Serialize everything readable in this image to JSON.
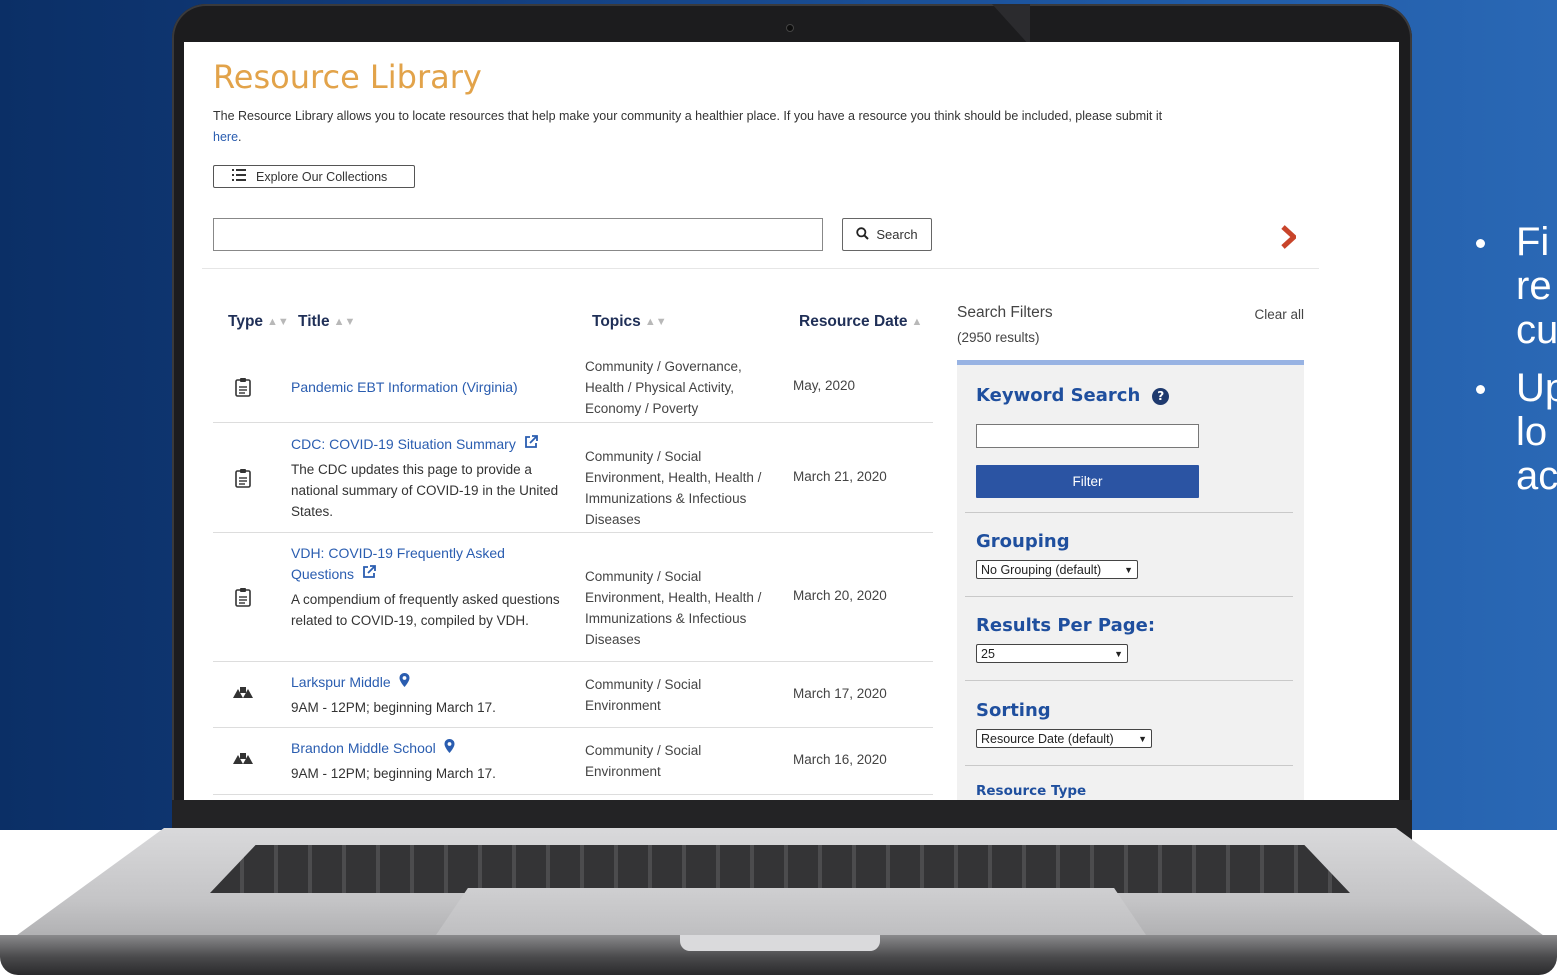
{
  "slide": {
    "bullets": [
      {
        "lines": [
          "Fi",
          "re",
          "cu"
        ]
      },
      {
        "lines": [
          "Up",
          "lo",
          "ac"
        ]
      }
    ]
  },
  "page": {
    "title": "Resource Library",
    "intro_text": "The Resource Library allows you to locate resources that help make your community a healthier place. If you have a resource you think should be included, please submit it ",
    "intro_link": "here",
    "intro_end": ".",
    "collections_button": "Explore Our Collections",
    "search_placeholder": "",
    "search_button": "Search"
  },
  "table": {
    "headers": {
      "type": "Type",
      "title": "Title",
      "topics": "Topics",
      "date": "Resource Date"
    },
    "rows": [
      {
        "icon": "document-icon",
        "title": "Pandemic EBT Information (Virginia)",
        "external": false,
        "location": false,
        "desc": "",
        "topics": "Community / Governance, Health / Physical Activity, Economy / Poverty",
        "date": "May, 2020"
      },
      {
        "icon": "document-icon",
        "title": "CDC: COVID-19 Situation Summary",
        "external": true,
        "location": false,
        "desc": "The CDC updates this page to provide a national summary of COVID-19 in the United States.",
        "topics": "Community / Social Environment, Health, Health / Immunizations & Infectious Diseases",
        "date": "March 21, 2020"
      },
      {
        "icon": "document-icon",
        "title": "VDH: COVID-19 Frequently Asked Questions",
        "external": true,
        "location": false,
        "desc": "A compendium of frequently asked questions related to COVID-19, compiled by VDH.",
        "topics": "Community / Social Environment, Health, Health / Immunizations & Infectious Diseases",
        "date": "March 20, 2020"
      },
      {
        "icon": "community-icon",
        "title": "Larkspur Middle",
        "external": false,
        "location": true,
        "desc": "9AM - 12PM; beginning March 17.",
        "topics": "Community / Social Environment",
        "date": "March 17, 2020"
      },
      {
        "icon": "community-icon",
        "title": "Brandon Middle School",
        "external": false,
        "location": true,
        "desc": "9AM - 12PM; beginning March 17.",
        "topics": "Community / Social Environment",
        "date": "March 16, 2020"
      }
    ]
  },
  "filters": {
    "title": "Search Filters",
    "count": "(2950 results)",
    "clear_all": "Clear all",
    "keyword_title": "Keyword Search",
    "keyword_value": "",
    "filter_button": "Filter",
    "grouping_title": "Grouping",
    "grouping_value": "No Grouping (default)",
    "results_title": "Results Per Page:",
    "results_value": "25",
    "sorting_title": "Sorting",
    "sorting_value": "Resource Date (default)",
    "resource_type_title": "Resource Type"
  },
  "colors": {
    "title_orange": "#e2a34a",
    "link_blue": "#2a5db0",
    "filter_button": "#2b54a3",
    "chevron_red": "#c8442a"
  }
}
